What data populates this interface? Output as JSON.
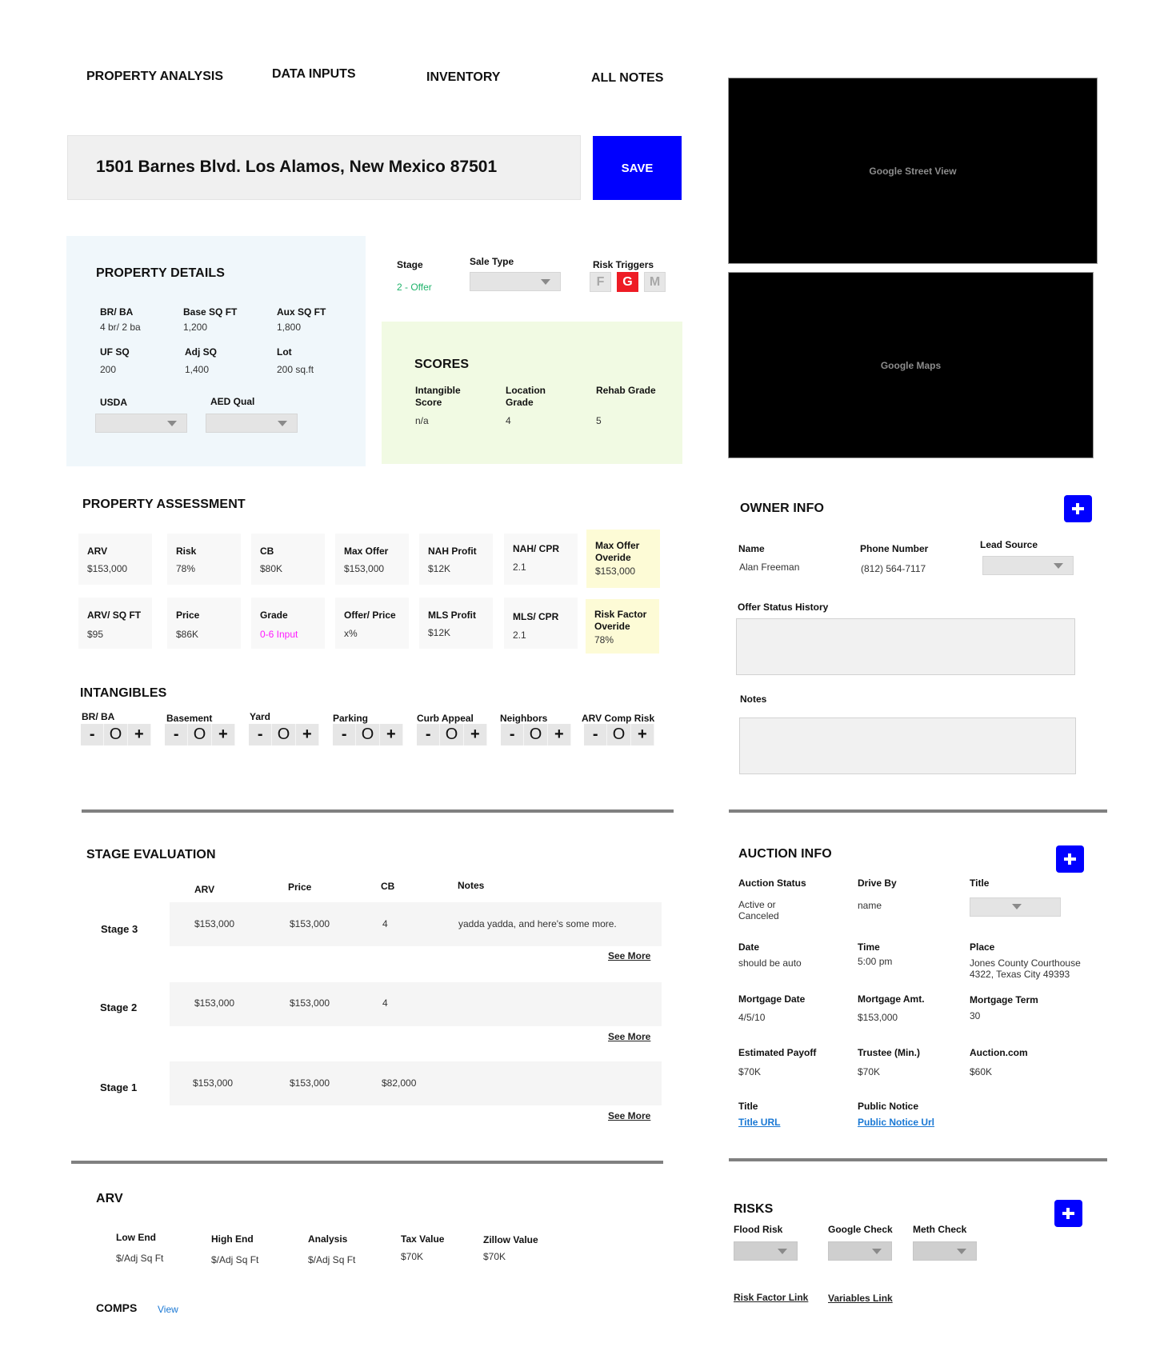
{
  "nav": {
    "tabs": [
      {
        "label": "PROPERTY ANALYSIS"
      },
      {
        "label": "DATA INPUTS"
      },
      {
        "label": "INVENTORY"
      },
      {
        "label": "ALL NOTES"
      }
    ]
  },
  "header": {
    "address": "1501 Barnes Blvd. Los Alamos, New Mexico 87501",
    "save_label": "SAVE"
  },
  "media": {
    "street_view": "Google Street View",
    "maps": "Google Maps"
  },
  "property_details": {
    "title": "PROPERTY DETAILS",
    "fields": [
      {
        "label": "BR/ BA",
        "value": "4 br/ 2 ba"
      },
      {
        "label": "Base SQ FT",
        "value": "1,200"
      },
      {
        "label": "Aux SQ FT",
        "value": "1,800"
      },
      {
        "label": "UF SQ",
        "value": "200"
      },
      {
        "label": "Adj SQ",
        "value": "1,400"
      },
      {
        "label": "Lot",
        "value": "200 sq.ft"
      }
    ],
    "usda_label": "USDA",
    "aed_label": "AED Qual"
  },
  "status": {
    "stage_label": "Stage",
    "stage_value": "2 - Offer",
    "stage_color": "#1fb36b",
    "sale_type_label": "Sale Type",
    "risk_triggers_label": "Risk Triggers",
    "risk_triggers": [
      {
        "letter": "F",
        "active": false
      },
      {
        "letter": "G",
        "active": true
      },
      {
        "letter": "M",
        "active": false
      }
    ]
  },
  "scores": {
    "title": "SCORES",
    "items": [
      {
        "label": "Intangible Score",
        "value": "n/a"
      },
      {
        "label": "Location Grade",
        "value": "4"
      },
      {
        "label": "Rehab Grade",
        "value": "5"
      }
    ]
  },
  "assessment": {
    "title": "PROPERTY ASSESSMENT",
    "row1": [
      {
        "label": "ARV",
        "value": "$153,000"
      },
      {
        "label": "Risk",
        "value": "78%"
      },
      {
        "label": "CB",
        "value": "$80K"
      },
      {
        "label": "Max Offer",
        "value": "$153,000"
      },
      {
        "label": "NAH Profit",
        "value": "$12K"
      },
      {
        "label": "NAH/ CPR",
        "value": "2.1"
      },
      {
        "label": "Max Offer Overide",
        "value": "$153,000"
      }
    ],
    "row2": [
      {
        "label": "ARV/ SQ FT",
        "value": "$95"
      },
      {
        "label": "Price",
        "value": "$86K"
      },
      {
        "label": "Grade",
        "value": "0-6 Input"
      },
      {
        "label": "Offer/ Price",
        "value": "x%"
      },
      {
        "label": "MLS Profit",
        "value": "$12K"
      },
      {
        "label": "MLS/ CPR",
        "value": "2.1"
      },
      {
        "label": "Risk Factor Overide",
        "value": "78%"
      }
    ],
    "grade_color": "#ff1aff"
  },
  "intangibles": {
    "title": "INTANGIBLES",
    "items": [
      {
        "label": "BR/ BA",
        "value": "O"
      },
      {
        "label": "Basement",
        "value": "O"
      },
      {
        "label": "Yard",
        "value": "O"
      },
      {
        "label": "Parking",
        "value": "O"
      },
      {
        "label": "Curb Appeal",
        "value": "O"
      },
      {
        "label": "Neighbors",
        "value": "O"
      },
      {
        "label": "ARV Comp Risk",
        "value": "O"
      }
    ],
    "minus": "-",
    "plus": "+"
  },
  "owner": {
    "title": "OWNER INFO",
    "name_label": "Name",
    "name": "Alan Freeman",
    "phone_label": "Phone Number",
    "phone": "(812) 564-7117",
    "lead_source_label": "Lead Source",
    "offer_history_label": "Offer Status History",
    "notes_label": "Notes"
  },
  "stage_eval": {
    "title": "STAGE EVALUATION",
    "columns": [
      "ARV",
      "Price",
      "CB",
      "Notes"
    ],
    "rows": [
      {
        "stage": "Stage 3",
        "arv": "$153,000",
        "price": "$153,000",
        "cb": "4",
        "notes": "yadda yadda, and here's some more."
      },
      {
        "stage": "Stage 2",
        "arv": "$153,000",
        "price": "$153,000",
        "cb": "4",
        "notes": ""
      },
      {
        "stage": "Stage 1",
        "arv": "$153,000",
        "price": "$153,000",
        "cb": "$82,000",
        "notes": ""
      }
    ],
    "see_more": "See More"
  },
  "auction": {
    "title": "AUCTION INFO",
    "status_label": "Auction Status",
    "status_value": "Active or\nCanceled",
    "drive_by_label": "Drive By",
    "drive_by_value": "name",
    "title_label": "Title",
    "date_label": "Date",
    "date_value": "should be auto",
    "time_label": "Time",
    "time_value": "5:00 pm",
    "place_label": "Place",
    "place_value": "Jones County Courthouse\n4322, Texas City 49393",
    "mortgage_date_label": "Mortgage Date",
    "mortgage_date_value": "4/5/10",
    "mortgage_amt_label": "Mortgage Amt.",
    "mortgage_amt_value": "$153,000",
    "mortgage_term_label": "Mortgage Term",
    "mortgage_term_value": "30",
    "payoff_label": "Estimated Payoff",
    "payoff_value": "$70K",
    "trustee_label": "Trustee (Min.)",
    "trustee_value": "$70K",
    "auctioncom_label": "Auction.com",
    "auctioncom_value": "$60K",
    "title2_label": "Title",
    "title_url": "Title URL",
    "public_notice_label": "Public Notice",
    "public_notice_url": "Public Notice Url"
  },
  "arv": {
    "title": "ARV",
    "items": [
      {
        "label": "Low End",
        "value": "$/Adj Sq Ft"
      },
      {
        "label": "High End",
        "value": "$/Adj Sq Ft"
      },
      {
        "label": "Analysis",
        "value": "$/Adj Sq Ft"
      },
      {
        "label": "Tax Value",
        "value": "$70K"
      },
      {
        "label": "Zillow Value",
        "value": "$70K"
      }
    ],
    "comps_label": "COMPS",
    "comps_view": "View"
  },
  "risks": {
    "title": "RISKS",
    "flood_label": "Flood Risk",
    "google_label": "Google Check",
    "meth_label": "Meth Check",
    "risk_factor_link": "Risk Factor Link",
    "variables_link": "Variables Link"
  },
  "colors": {
    "accent": "#0000ff",
    "risk_active": "#ee1c25",
    "details_bg": "#f0f7fb",
    "scores_bg": "#f1fae3",
    "override_bg": "#fdfbd6",
    "link": "#1a78d4"
  }
}
